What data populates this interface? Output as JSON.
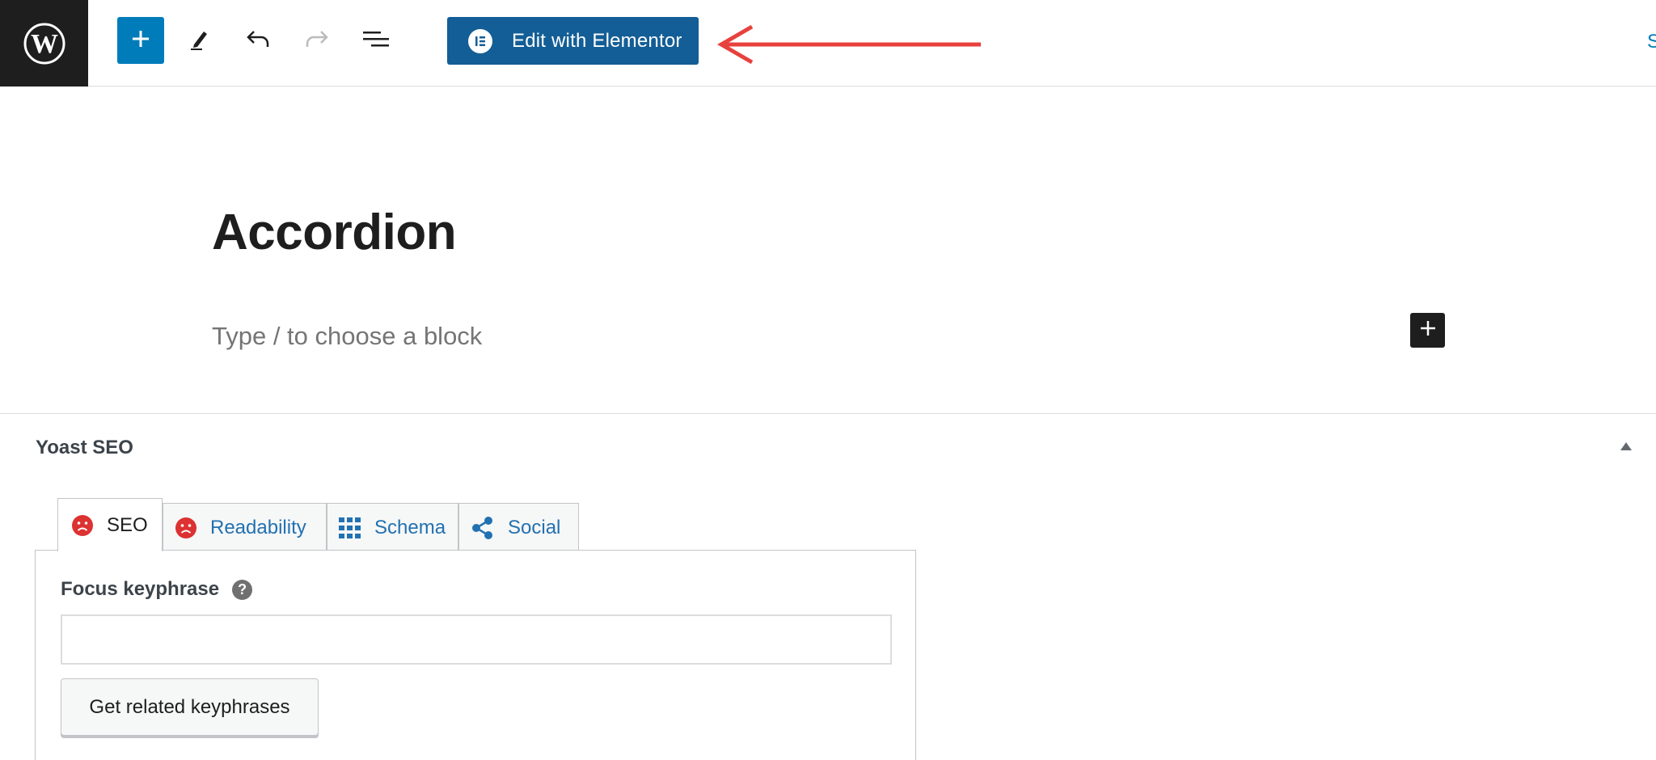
{
  "toolbar": {
    "wp_logo_icon": "wordpress-logo-icon",
    "add_block_icon": "plus-icon",
    "tools_icon": "pencil-icon",
    "undo_icon": "undo-icon",
    "redo_icon": "redo-icon",
    "list_view_icon": "list-view-icon",
    "elementor_button_label": "Edit with Elementor",
    "elementor_icon": "elementor-icon",
    "save_link_label": "S",
    "accent_color": "#007cba",
    "elementor_color": "#135e96",
    "annotation_arrow_color": "#e8413d"
  },
  "editor": {
    "title": "Accordion",
    "block_placeholder": "Type / to choose a block"
  },
  "yoast": {
    "title": "Yoast SEO",
    "tabs": [
      {
        "label": "SEO",
        "icon": "sad-face-icon",
        "active": true
      },
      {
        "label": "Readability",
        "icon": "sad-face-icon",
        "active": false
      },
      {
        "label": "Schema",
        "icon": "grid-icon",
        "active": false
      },
      {
        "label": "Social",
        "icon": "share-icon",
        "active": false
      }
    ],
    "focus_keyphrase_label": "Focus keyphrase",
    "focus_keyphrase_value": "",
    "related_button_label": "Get related keyphrases",
    "bad_score_color": "#dc3232"
  }
}
